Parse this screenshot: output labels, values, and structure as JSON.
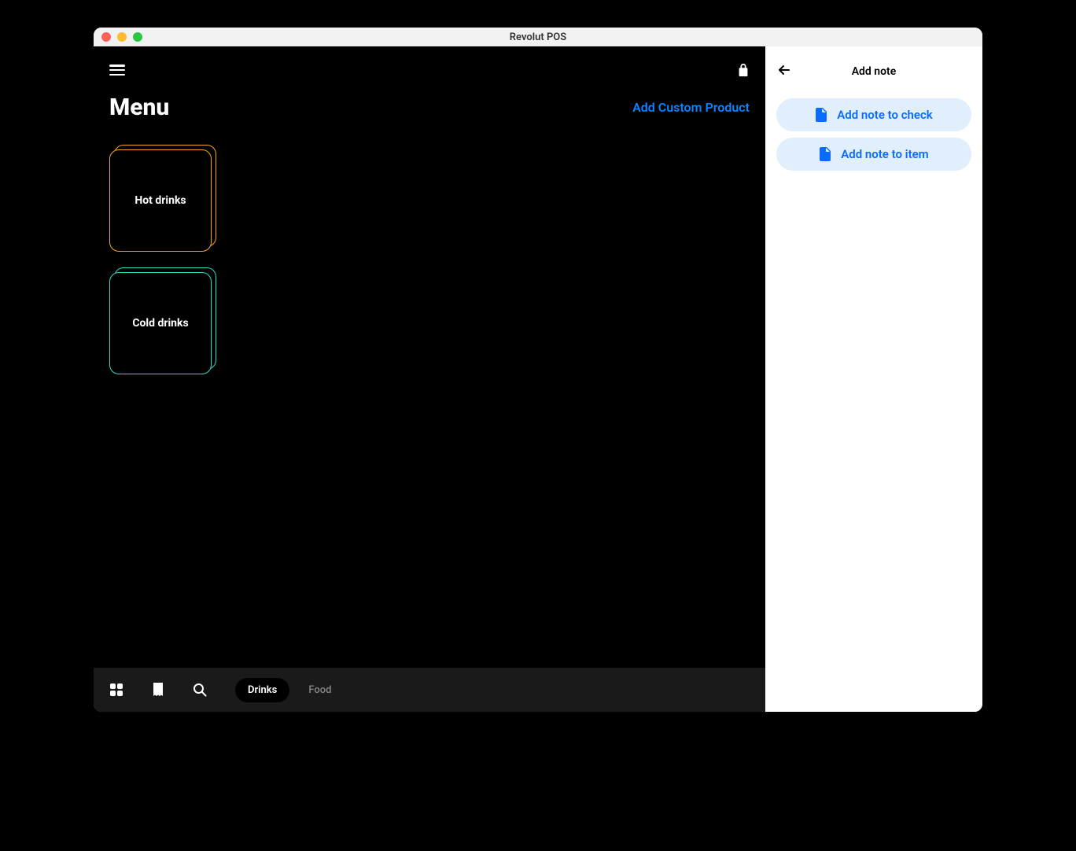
{
  "window": {
    "title": "Revolut POS"
  },
  "main": {
    "page_title": "Menu",
    "add_custom_label": "Add Custom Product",
    "categories": [
      {
        "label": "Hot drinks",
        "variant": "orange"
      },
      {
        "label": "Cold drinks",
        "variant": "teal"
      }
    ]
  },
  "bottombar": {
    "tabs": [
      {
        "label": "Drinks",
        "active": true
      },
      {
        "label": "Food",
        "active": false
      }
    ]
  },
  "panel": {
    "title": "Add note",
    "buttons": [
      {
        "label": "Add note to check"
      },
      {
        "label": "Add note to item"
      }
    ]
  }
}
